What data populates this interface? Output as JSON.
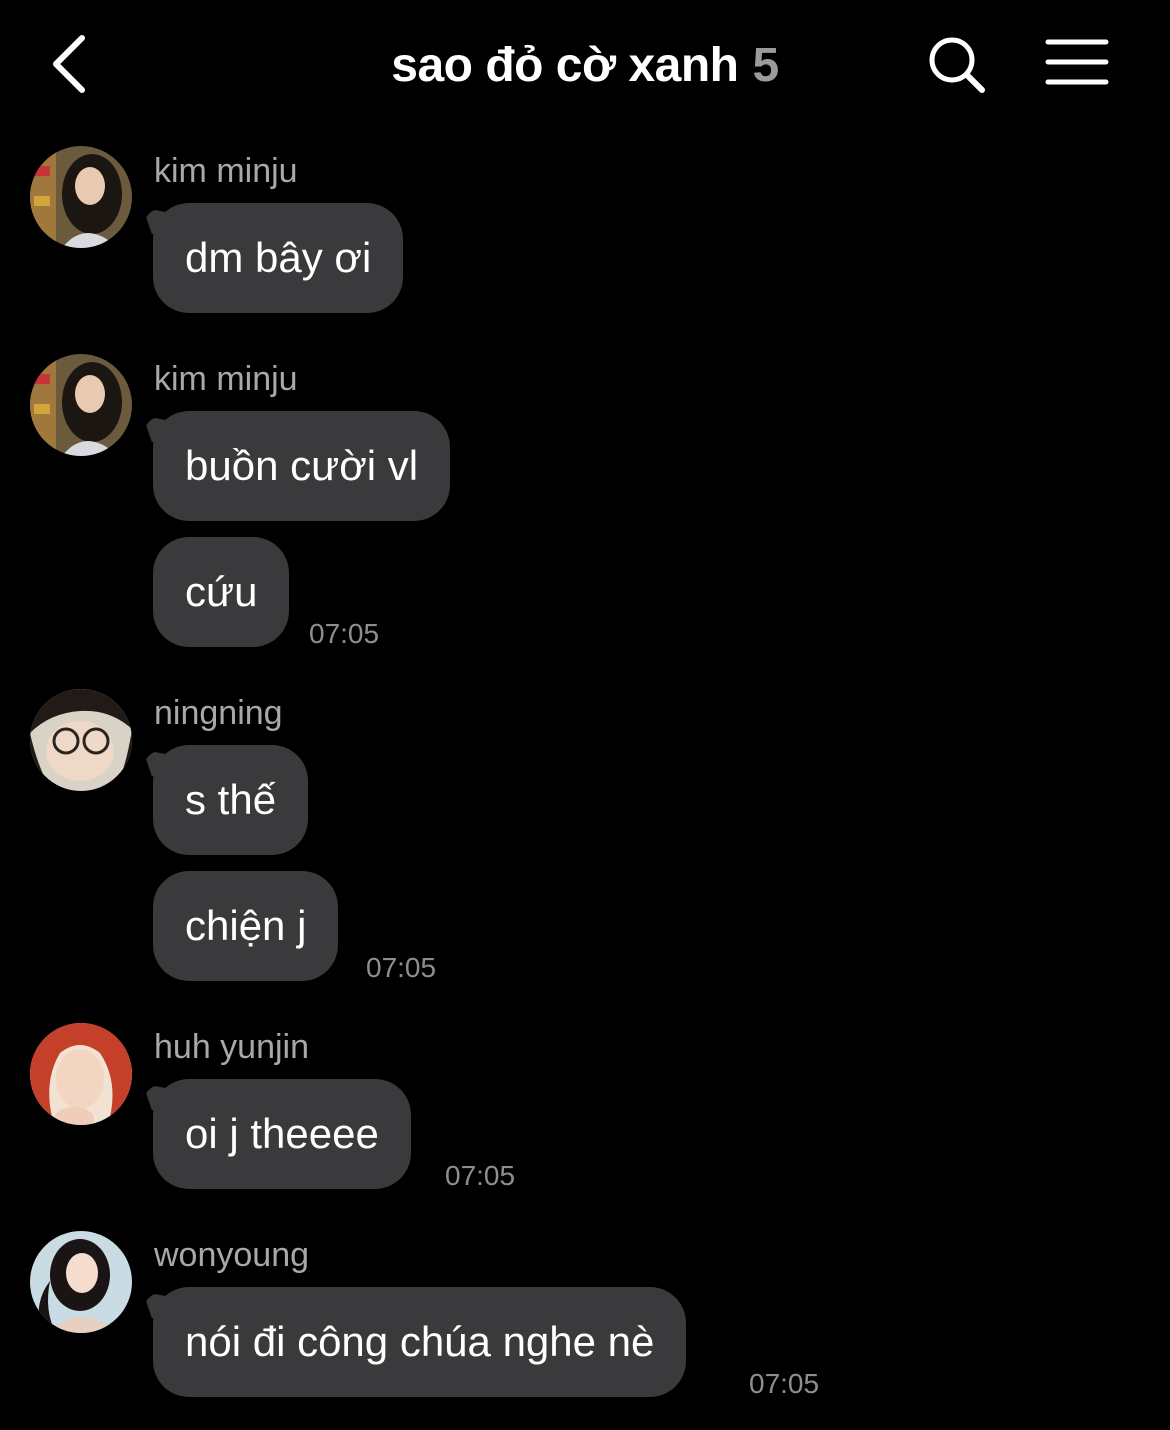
{
  "header": {
    "title": "sao đỏ cờ xanh",
    "member_count": "5",
    "icons": {
      "back": "chevron-left-icon",
      "search": "search-icon",
      "menu": "hamburger-menu-icon"
    }
  },
  "groups": [
    {
      "sender": "kim minju",
      "messages": [
        {
          "text": "dm bây ơi"
        }
      ]
    },
    {
      "sender": "kim minju",
      "messages": [
        {
          "text": "buồn cười vl"
        },
        {
          "text": "cứu",
          "time": "07:05"
        }
      ]
    },
    {
      "sender": "ningning",
      "messages": [
        {
          "text": "s thế"
        },
        {
          "text": "chiện j",
          "time": "07:05"
        }
      ]
    },
    {
      "sender": "huh yunjin",
      "messages": [
        {
          "text": "oi j theeee",
          "time": "07:05"
        }
      ]
    },
    {
      "sender": "wonyoung",
      "messages": [
        {
          "text": "nói đi công chúa nghe nè",
          "time": "07:05"
        }
      ]
    }
  ],
  "colors": {
    "background": "#000000",
    "bubble": "#3a3a3c",
    "secondary_text": "#a8a8a8",
    "time_text": "#8e8e8e"
  }
}
